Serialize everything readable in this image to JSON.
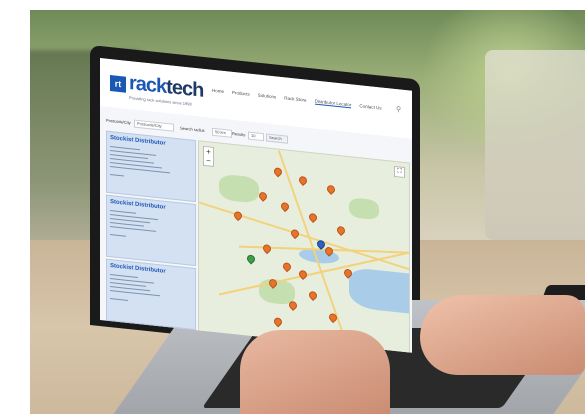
{
  "brand": {
    "logo_mark": "rt",
    "name_part1": "rack",
    "name_part2": "tech",
    "tagline": "Providing rack solutions since 1998",
    "accent_color": "#1b57b5"
  },
  "nav": {
    "items": [
      "Home",
      "Products",
      "Solutions",
      "Rack Store",
      "Distributor Locator",
      "Contact Us"
    ],
    "active_index": 4,
    "search_icon": "search-icon"
  },
  "filters": {
    "label1": "Postcode/City",
    "value1": "Postcode/City",
    "label2": "Search radius",
    "value2": "50 km",
    "label3": "Results",
    "value3": "10",
    "search_button": "Search"
  },
  "sidebar": {
    "cards": [
      {
        "title": "Stockist Distributor"
      },
      {
        "title": "Stockist Distributor"
      },
      {
        "title": "Stockist Distributor"
      }
    ]
  },
  "map": {
    "zoom_in": "+",
    "zoom_out": "−",
    "fullscreen_icon": "fullscreen-icon",
    "pin_color": "#e8742a"
  }
}
